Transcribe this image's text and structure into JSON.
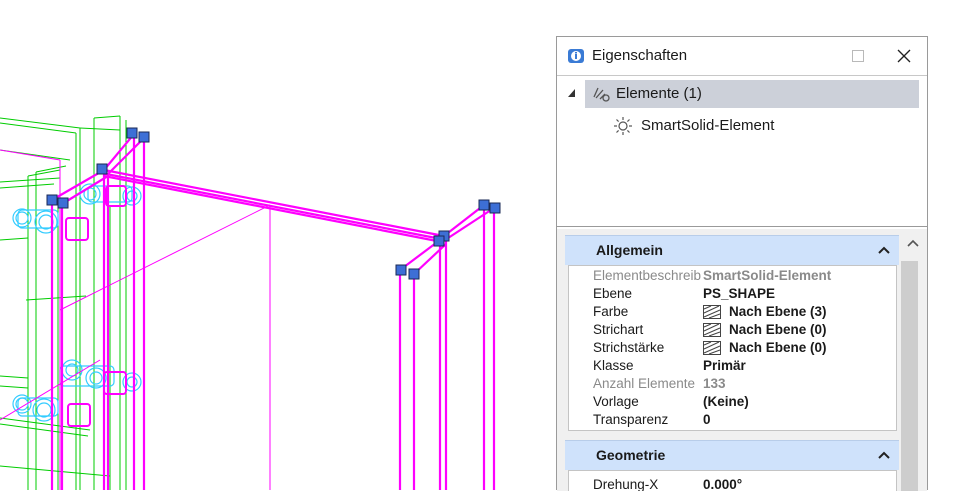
{
  "panel": {
    "title": "Eigenschaften",
    "window_buttons": {
      "minimize": "minimize-icon",
      "maximize": "maximize-icon",
      "close": "close-icon"
    }
  },
  "tree": {
    "root_label": "Elemente (1)",
    "child_label": "SmartSolid-Element"
  },
  "sections": {
    "general": {
      "header": "Allgemein",
      "rows": [
        {
          "name": "Elementbeschreib",
          "value": "SmartSolid-Element",
          "dim": true
        },
        {
          "name": "Ebene",
          "value": "PS_SHAPE"
        },
        {
          "name": "Farbe",
          "value": "Nach Ebene (3)",
          "swatch": true
        },
        {
          "name": "Strichart",
          "value": "Nach Ebene (0)",
          "swatch": true
        },
        {
          "name": "Strichstärke",
          "value": "Nach Ebene (0)",
          "swatch": true
        },
        {
          "name": "Klasse",
          "value": "Primär"
        },
        {
          "name": "Anzahl Elemente",
          "value": "133",
          "dim": true
        },
        {
          "name": "Vorlage",
          "value": "(Keine)"
        },
        {
          "name": "Transparenz",
          "value": "0"
        }
      ]
    },
    "geometry": {
      "header": "Geometrie",
      "rows": [
        {
          "name": "Drehung-X",
          "value": "0.000°"
        }
      ]
    }
  },
  "colors": {
    "wire_magenta": "#ff00ff",
    "wire_green": "#00cc00",
    "wire_cyan": "#33ccff",
    "section_header": "#cfe2fb",
    "tree_selection": "#ccd0d9"
  }
}
